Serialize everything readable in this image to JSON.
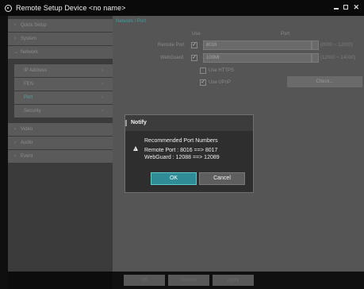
{
  "window": {
    "title": "Remote Setup Device  <no name>",
    "icon": "app-icon",
    "controls": [
      "minimize-icon",
      "maximize-icon",
      "close-icon"
    ]
  },
  "sidebar": {
    "items": [
      {
        "label": "Quick Setup",
        "icon": "chevron-right-icon"
      },
      {
        "label": "System",
        "icon": "chevron-right-icon"
      },
      {
        "label": "Network",
        "icon": "chevron-down-icon"
      },
      {
        "label": "Video",
        "icon": "chevron-right-icon"
      },
      {
        "label": "Audio",
        "icon": "chevron-right-icon"
      },
      {
        "label": "Event",
        "icon": "chevron-right-icon"
      }
    ],
    "network_subitems": [
      {
        "label": "IP Address"
      },
      {
        "label": "FEN"
      },
      {
        "label": "Port",
        "active": true
      },
      {
        "label": "Security"
      }
    ]
  },
  "main": {
    "breadcrumb": "Network / Port",
    "col_use": "Use",
    "col_port": "Port",
    "remote_port": {
      "label": "Remote Port",
      "value": "8016",
      "range": "(8000 ~ 12000)"
    },
    "webguard": {
      "label": "WebGuard",
      "value": "100MI",
      "range": "(12000 ~ 14000)"
    },
    "use_https": "Use HTTPS",
    "use_upnp": "Use UPnP",
    "check_button": "Check..."
  },
  "bottom": {
    "ok": "OK",
    "cancel": "Cancel",
    "apply": "Apply"
  },
  "dialog": {
    "title": "Notify",
    "heading": "Recommended Port Numbers",
    "line1": "Remote Port : 8016 ==> 8017",
    "line2": "WebGuard : 12088 ==> 12089",
    "ok": "OK",
    "cancel": "Cancel"
  },
  "colors": {
    "accent": "#3f9fa0",
    "ok_button": "#2f8c97"
  }
}
